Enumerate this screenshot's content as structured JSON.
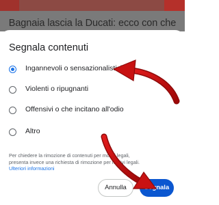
{
  "background": {
    "headline": "Bagnaia lascia la Ducati: ecco con che"
  },
  "dialog": {
    "title": "Segnala contenuti",
    "options": [
      {
        "label": "Ingannevoli o sensazionalistici",
        "selected": true
      },
      {
        "label": "Violenti o ripugnanti",
        "selected": false
      },
      {
        "label": "Offensivi o che incitano all'odio",
        "selected": false
      },
      {
        "label": "Altro",
        "selected": false
      }
    ],
    "legal_line1": "Per chiedere la rimozione di contenuti per motivi legali,",
    "legal_line2": "presenta invece una richiesta di rimozione per motivi legali.",
    "legal_link": "Ulteriori informazioni",
    "cancel_label": "Annulla",
    "report_label": "Segnala"
  },
  "colors": {
    "accent": "#1a73e8",
    "primary_button": "#0b57d0",
    "annotation_arrow": "#d40f0f"
  }
}
